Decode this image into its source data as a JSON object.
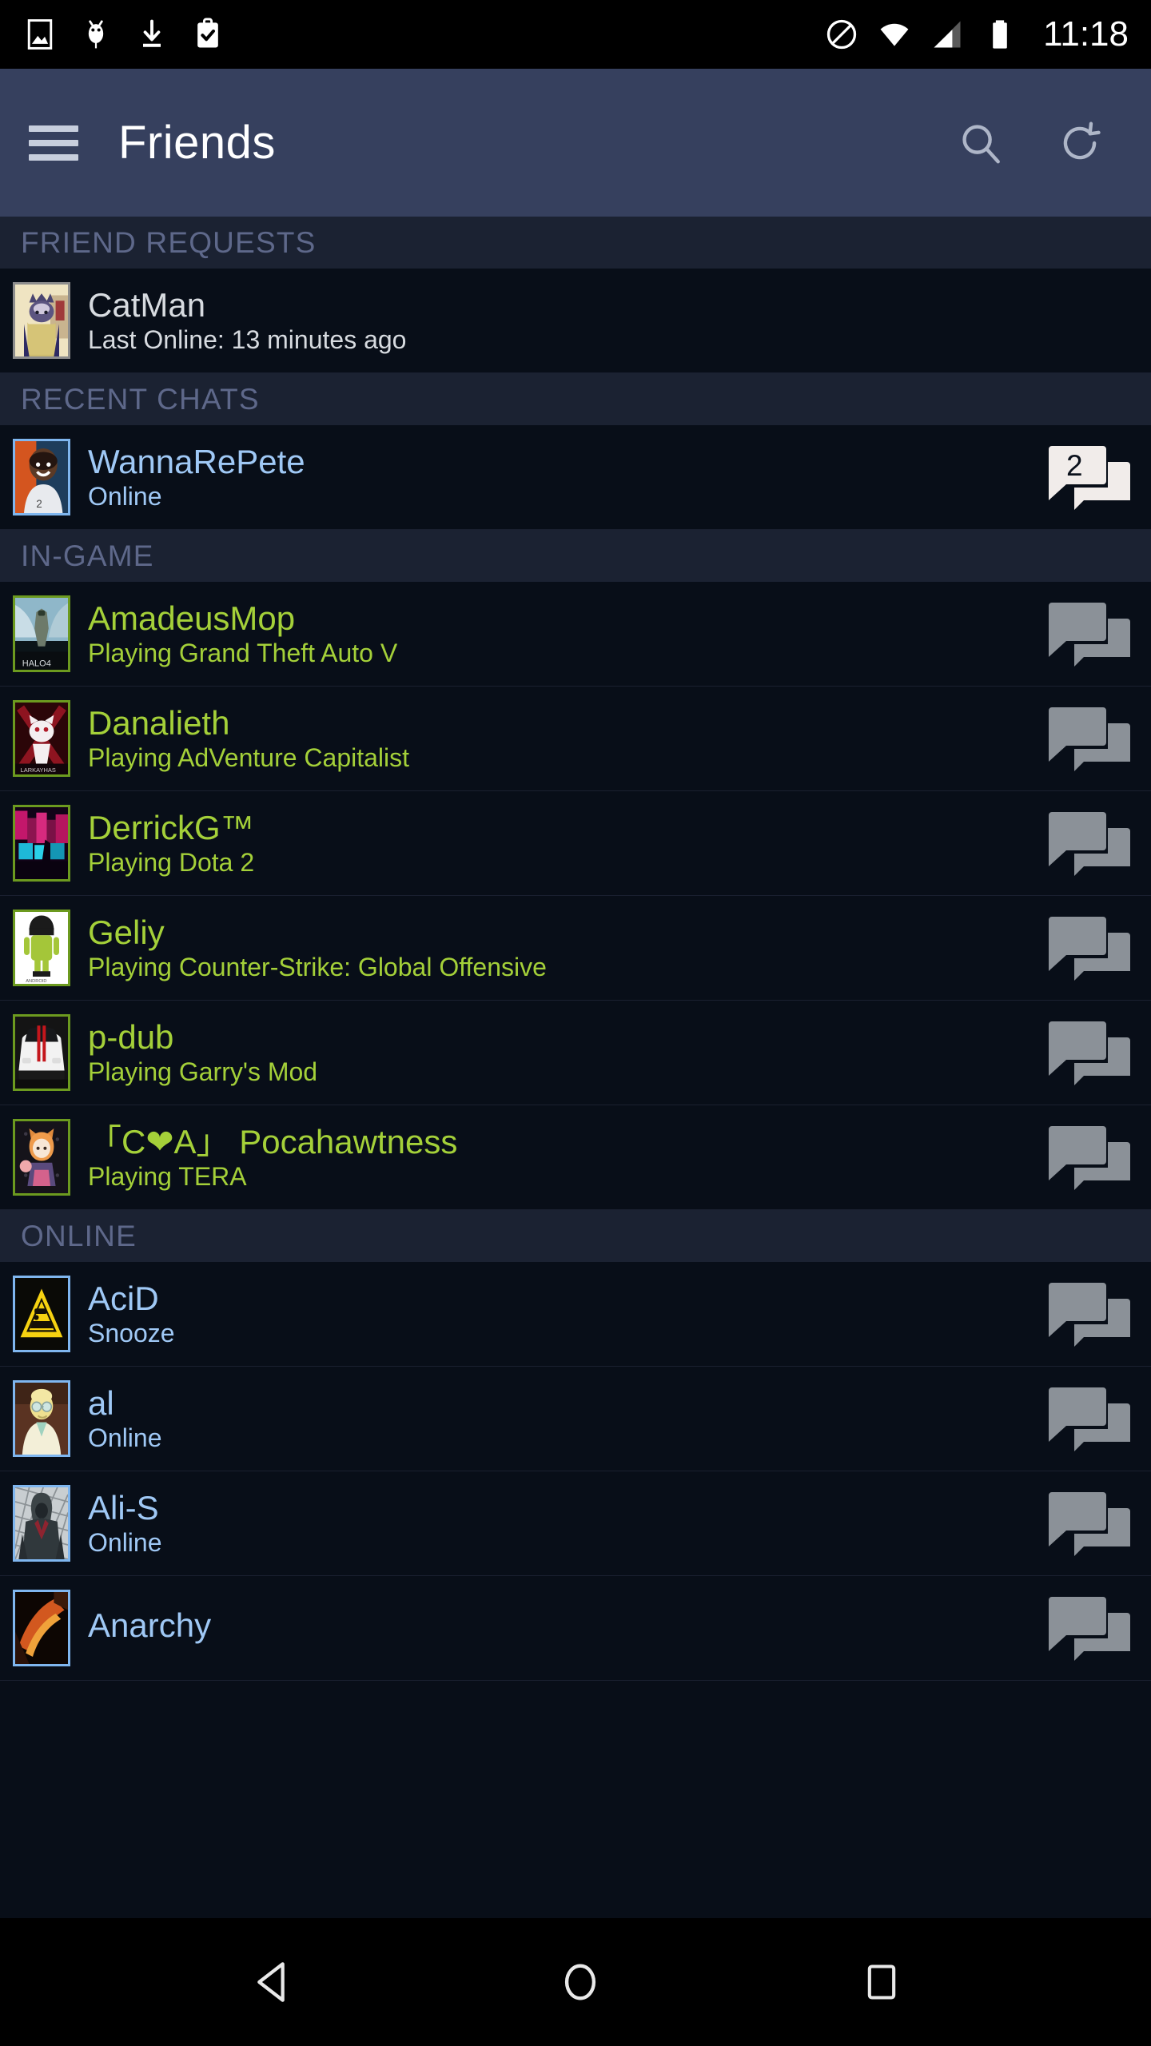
{
  "statusbar": {
    "time": "11:18",
    "left_icons": [
      "image-icon",
      "android-bug-icon",
      "download-icon",
      "clipboard-check-icon"
    ],
    "right_icons": [
      "do-not-disturb-icon",
      "wifi-icon",
      "cell-signal-icon",
      "battery-full-icon"
    ]
  },
  "appbar": {
    "menu_icon": "hamburger-menu-icon",
    "title": "Friends",
    "search_icon": "search-icon",
    "refresh_icon": "refresh-icon"
  },
  "colors": {
    "appbar_bg": "#36405e",
    "section_header_bg": "#1b2232",
    "section_header_text": "#5e688a",
    "row_bg": "#080e18",
    "ingame_green": "#a4d039",
    "online_blue": "#9fc8f5",
    "offline_grey": "#d7dbe0",
    "chat_icon_grey": "#8b9198",
    "chat_icon_unread": "#f1ecea"
  },
  "sections": [
    {
      "title": "FRIEND REQUESTS",
      "rows": [
        {
          "name": "CatMan",
          "status": "Last Online: 13 minutes ago",
          "state": "request",
          "avatar": "catman-avatar",
          "chat_icon": false,
          "unread": null
        }
      ]
    },
    {
      "title": "RECENT CHATS",
      "rows": [
        {
          "name": "WannaRePete",
          "status": "Online",
          "state": "online",
          "avatar": "wannarepete-avatar",
          "chat_icon": true,
          "unread": "2"
        }
      ]
    },
    {
      "title": "IN-GAME",
      "rows": [
        {
          "name": "AmadeusMop",
          "status": "Playing Grand Theft Auto V",
          "state": "ingame",
          "avatar": "halo4-avatar",
          "chat_icon": true,
          "unread": null
        },
        {
          "name": "Danalieth",
          "status": "Playing AdVenture Capitalist",
          "state": "ingame",
          "avatar": "danalieth-avatar",
          "chat_icon": true,
          "unread": null
        },
        {
          "name": "DerrickG™",
          "status": "Playing Dota 2",
          "state": "ingame",
          "avatar": "derrickg-avatar",
          "chat_icon": true,
          "unread": null
        },
        {
          "name": "Geliy",
          "status": "Playing Counter-Strike: Global Offensive",
          "state": "ingame",
          "avatar": "android-robot-avatar",
          "chat_icon": true,
          "unread": null
        },
        {
          "name": "p-dub",
          "status": "Playing Garry's Mod",
          "state": "ingame",
          "avatar": "white-car-avatar",
          "chat_icon": true,
          "unread": null
        },
        {
          "name": "「C❤A」 Pocahawtness",
          "status": "Playing TERA",
          "state": "ingame",
          "avatar": "anime-fox-avatar",
          "chat_icon": true,
          "unread": null
        }
      ]
    },
    {
      "title": "ONLINE",
      "rows": [
        {
          "name": "AciD",
          "status": "Snooze",
          "state": "online",
          "avatar": "hazard-sign-avatar",
          "chat_icon": true,
          "unread": null
        },
        {
          "name": "al",
          "status": "Online",
          "state": "online",
          "avatar": "professor-avatar",
          "chat_icon": true,
          "unread": null
        },
        {
          "name": "Ali-S",
          "status": "Online",
          "state": "online",
          "avatar": "hooded-assassin-avatar",
          "chat_icon": true,
          "unread": null
        },
        {
          "name": "Anarchy",
          "status": "",
          "state": "online",
          "avatar": "anarchy-avatar",
          "chat_icon": true,
          "unread": null
        }
      ]
    }
  ],
  "navbar": {
    "back_icon": "back-triangle-icon",
    "home_icon": "home-circle-icon",
    "recents_icon": "recents-square-icon"
  }
}
